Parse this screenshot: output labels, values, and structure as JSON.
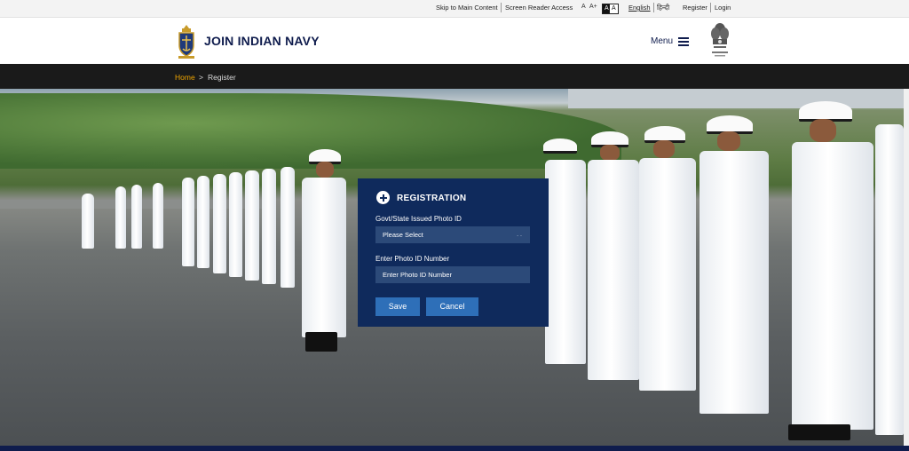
{
  "topbar": {
    "skip_link": "Skip to Main Content",
    "screen_reader": "Screen Reader Access",
    "font_small": "A",
    "font_large": "A+",
    "contrast_dark": "A",
    "contrast_light": "A",
    "lang_english": "English",
    "lang_hindi": "हिन्दी",
    "register": "Register",
    "login": "Login"
  },
  "header": {
    "brand": "JOIN INDIAN NAVY",
    "menu_label": "Menu"
  },
  "breadcrumb": {
    "home": "Home",
    "separator": ">",
    "current": "Register"
  },
  "registration": {
    "title": "REGISTRATION",
    "photo_id_label": "Govt/State Issued Photo ID",
    "photo_id_value": "Please Select",
    "photo_id_number_label": "Enter Photo ID Number",
    "photo_id_number_placeholder": "Enter Photo ID Number",
    "save": "Save",
    "cancel": "Cancel"
  },
  "colors": {
    "navy": "#0f1c4d",
    "panel": "#0f2a5c",
    "accent": "#f0a500",
    "button": "#2e6fb8"
  }
}
